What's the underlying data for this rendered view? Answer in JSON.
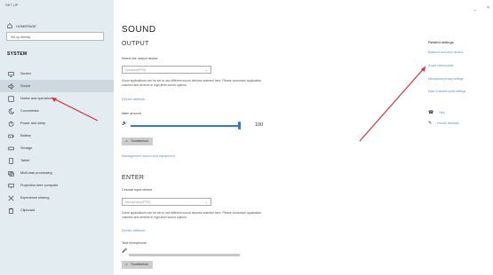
{
  "window": {
    "title": "SET UP",
    "minimize": "–",
    "close": "×"
  },
  "sidebar": {
    "home_label": "HOMEPAGE",
    "search_placeholder": "Set up directly",
    "section_title": "SYSTEM",
    "items": [
      {
        "label": "Screen",
        "icon": "monitor-icon"
      },
      {
        "label": "Sound",
        "icon": "speaker-icon",
        "active": true
      },
      {
        "label": "Notice and operation",
        "icon": "notification-icon"
      },
      {
        "label": "Concentrate",
        "icon": "moon-icon"
      },
      {
        "label": "Power and sleep",
        "icon": "power-icon"
      },
      {
        "label": "Battery",
        "icon": "battery-icon"
      },
      {
        "label": "Storage",
        "icon": "storage-icon"
      },
      {
        "label": "Tablet",
        "icon": "tablet-icon"
      },
      {
        "label": "Multi-task processing",
        "icon": "multitask-icon"
      },
      {
        "label": "Projection here computer",
        "icon": "projection-icon"
      },
      {
        "label": "Experience sharing",
        "icon": "share-icon"
      },
      {
        "label": "Clipboard",
        "icon": "clipboard-icon"
      }
    ]
  },
  "main": {
    "title": "SOUND",
    "output": {
      "heading": "OUTPUT",
      "device_label": "Select the output device",
      "device_value": "Speaker(IFPD)",
      "note": "Some applications can be set to use different sound devices selected here. Please customize application volumes and devices in high-level sound options.",
      "properties_link": "Device attribute",
      "volume_label": "Main amount",
      "volume_icon": "🔊",
      "volume_value": "100",
      "volume_level": 1.0,
      "troubleshoot_label": "Troubleshoot",
      "manage_link": "Management sound and equipment"
    },
    "input": {
      "heading": "ENTER",
      "device_label": "Choose input device",
      "device_value": "Microphone(IFPD)",
      "note": "Some applications can be set to use different sound devices selected here. Please customize application volumes and devices in high-level sound options.",
      "properties_link": "Device attribute",
      "test_label": "Test microphone",
      "mic_icon": "🎤",
      "mic_level": 0.0,
      "troubleshoot_label": "Troubleshoot"
    }
  },
  "related": {
    "heading": "Related settings",
    "links": [
      "Bluetooth and other devices",
      "Sound control panel",
      "Microphone privacy settings",
      "Ease of access audio settings"
    ],
    "help_label": "Help",
    "feedback_label": "Provide feedback"
  },
  "colors": {
    "accent": "#2e7bd1",
    "sidebar_bg": "#e3ecf1",
    "link": "#5b8fc7",
    "annotation": "#d9303a"
  }
}
